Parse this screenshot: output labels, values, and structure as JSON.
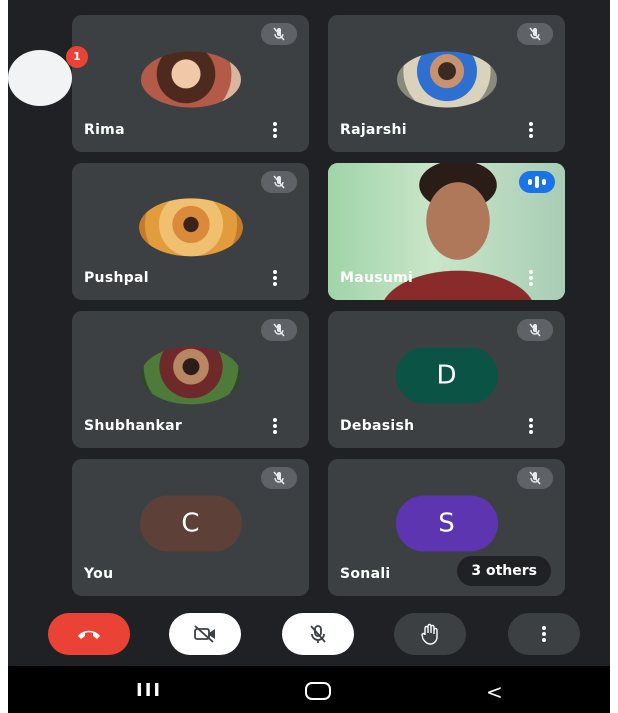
{
  "badge_count": "1",
  "participants": [
    {
      "name": "Rima",
      "type": "photo"
    },
    {
      "name": "Rajarshi",
      "type": "photo"
    },
    {
      "name": "Pushpal",
      "type": "photo"
    },
    {
      "name": "Mausumi",
      "type": "video",
      "speaking": true
    },
    {
      "name": "Shubhankar",
      "type": "photo"
    },
    {
      "name": "Debasish",
      "type": "initial",
      "initial": "D",
      "color": "#0b5345"
    },
    {
      "name": "You",
      "type": "initial",
      "initial": "C",
      "color": "#5d4037"
    },
    {
      "name": "Sonali",
      "type": "initial",
      "initial": "S",
      "color": "#5e35b1"
    }
  ],
  "others_label": "3 others",
  "controls": {
    "end_call_color": "#ea4335",
    "camera_icon": "camera-off-icon",
    "mic_icon": "mic-off-icon",
    "hand_icon": "raise-hand-icon",
    "more_icon": "more-vert-icon"
  },
  "nav": {
    "recents": "III",
    "home": "O",
    "back": "<"
  }
}
